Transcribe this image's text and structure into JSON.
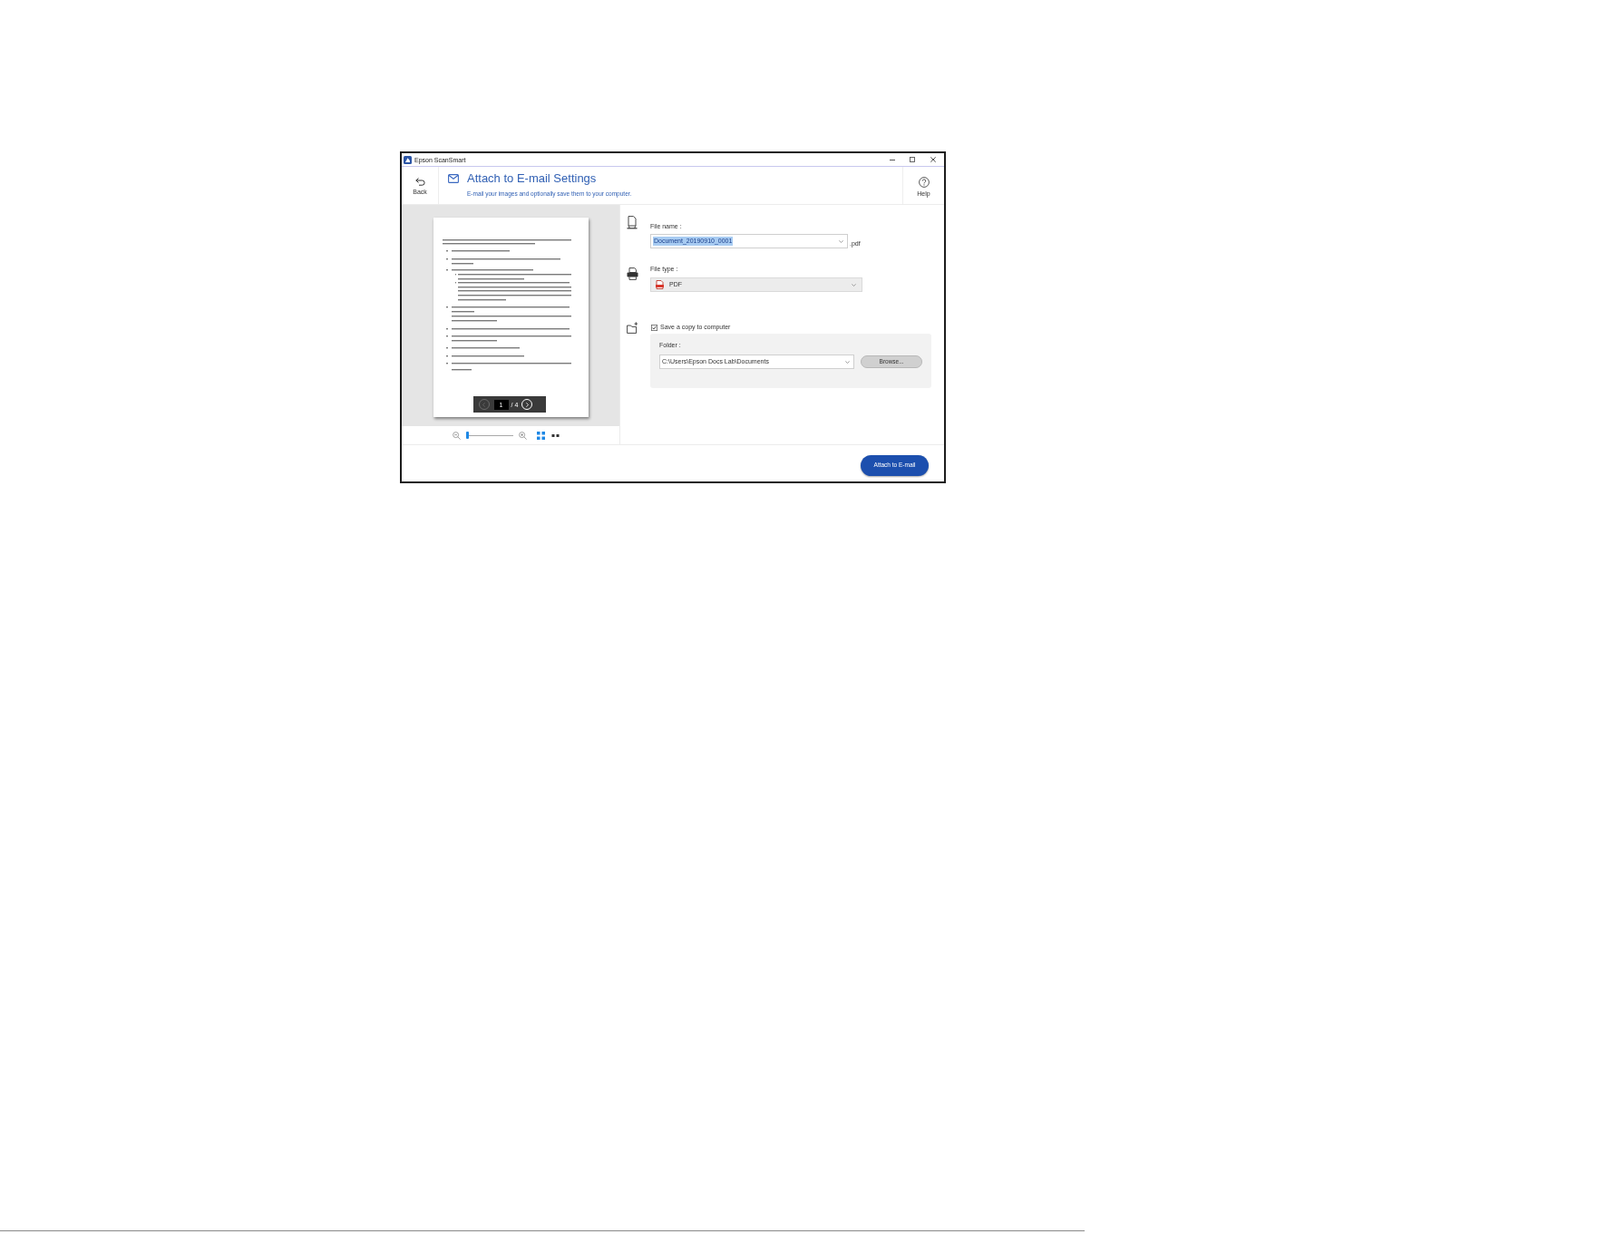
{
  "window": {
    "title": "Epson ScanSmart"
  },
  "header": {
    "back_label": "Back",
    "title": "Attach to E-mail Settings",
    "subtitle": "E-mail your images and optionally save them to your computer.",
    "help_label": "Help"
  },
  "preview": {
    "page_number": "1",
    "page_total": "/ 4",
    "prev_disabled": true,
    "next_disabled": false,
    "zoom_slider": {
      "level": 0
    },
    "fit_selected": true
  },
  "file_name": {
    "label": "File name :",
    "value": "Document_20190910_0001",
    "highlighted": true,
    "extension": ".pdf"
  },
  "file_type": {
    "label": "File type :",
    "value": "PDF"
  },
  "save_copy": {
    "label": "Save a copy to computer",
    "checked": true,
    "folder_label": "Folder :",
    "folder": "C:\\Users\\Epson Docs Lab\\Documents",
    "browse": "Browse..."
  },
  "primary_button": "Attach to E-mail"
}
